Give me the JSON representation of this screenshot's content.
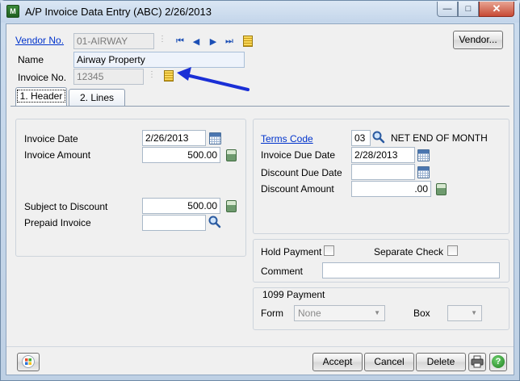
{
  "window": {
    "title": "A/P Invoice Data Entry (ABC) 2/26/2013",
    "app_icon_text": "M"
  },
  "header": {
    "vendor_no_label": "Vendor No.",
    "vendor_no_value": "01-AIRWAY",
    "name_label": "Name",
    "name_value": "Airway Property",
    "invoice_no_label": "Invoice No.",
    "invoice_no_value": "12345",
    "vendor_button": "Vendor..."
  },
  "tabs": [
    {
      "label": "1. Header",
      "active": true
    },
    {
      "label": "2. Lines",
      "active": false
    }
  ],
  "left_panel": {
    "invoice_date_label": "Invoice Date",
    "invoice_date_value": "2/26/2013",
    "invoice_amount_label": "Invoice Amount",
    "invoice_amount_value": "500.00",
    "subject_to_discount_label": "Subject to Discount",
    "subject_to_discount_value": "500.00",
    "prepaid_invoice_label": "Prepaid Invoice",
    "prepaid_invoice_value": ""
  },
  "right_panel": {
    "terms_code_label": "Terms Code",
    "terms_code_value": "03",
    "terms_description": "NET END OF MONTH",
    "invoice_due_date_label": "Invoice Due Date",
    "invoice_due_date_value": "2/28/2013",
    "discount_due_date_label": "Discount Due Date",
    "discount_due_date_value": "",
    "discount_amount_label": "Discount Amount",
    "discount_amount_value": ".00"
  },
  "payment_panel": {
    "hold_payment_label": "Hold Payment",
    "separate_check_label": "Separate Check",
    "comment_label": "Comment",
    "comment_value": ""
  },
  "panel_1099": {
    "title": "1099 Payment",
    "form_label": "Form",
    "form_value": "None",
    "box_label": "Box",
    "box_value": ""
  },
  "footer": {
    "accept": "Accept",
    "cancel": "Cancel",
    "delete": "Delete",
    "help_glyph": "?"
  },
  "colors": {
    "arrow": "#1a2fd6",
    "link": "#0033cc"
  }
}
